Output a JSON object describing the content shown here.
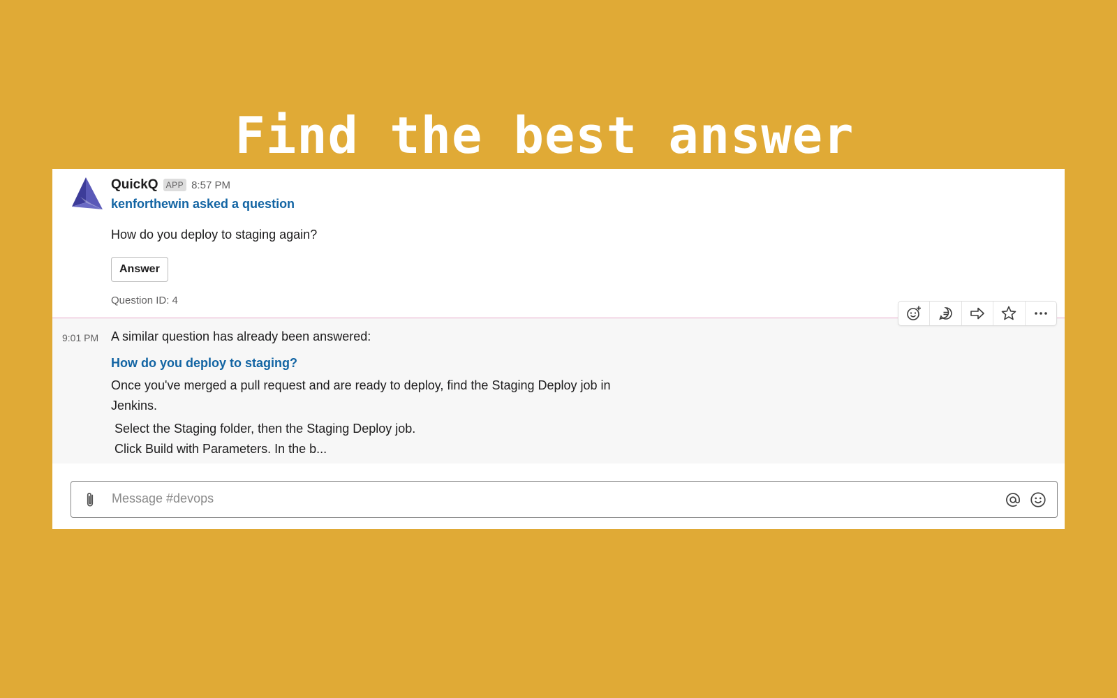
{
  "headline": "Find the best answer",
  "message1": {
    "author": "QuickQ",
    "badge": "APP",
    "time": "8:57 PM",
    "asked_by": "kenforthewin asked a question",
    "question": "How do you deploy to staging again?",
    "answer_button": "Answer",
    "question_id": "Question ID: 4"
  },
  "message2": {
    "time": "9:01 PM",
    "intro": "A similar question has already been answered:",
    "link_title": "How do you deploy to staging?",
    "body": "Once you've merged a pull request and are ready to deploy, find the Staging Deploy job in Jenkins.",
    "step1": "Select the Staging folder, then the Staging Deploy job.",
    "step2": "Click Build with Parameters. In the b..."
  },
  "hover_actions": [
    "add-reaction-icon",
    "start-thread-icon",
    "share-message-icon",
    "save-star-icon",
    "more-actions-icon"
  ],
  "composer": {
    "placeholder": "Message #devops"
  },
  "colors": {
    "background": "#e0aa36",
    "link": "#1264a3",
    "divider": "#e8a8c8",
    "avatar": "#4b4aa6"
  }
}
